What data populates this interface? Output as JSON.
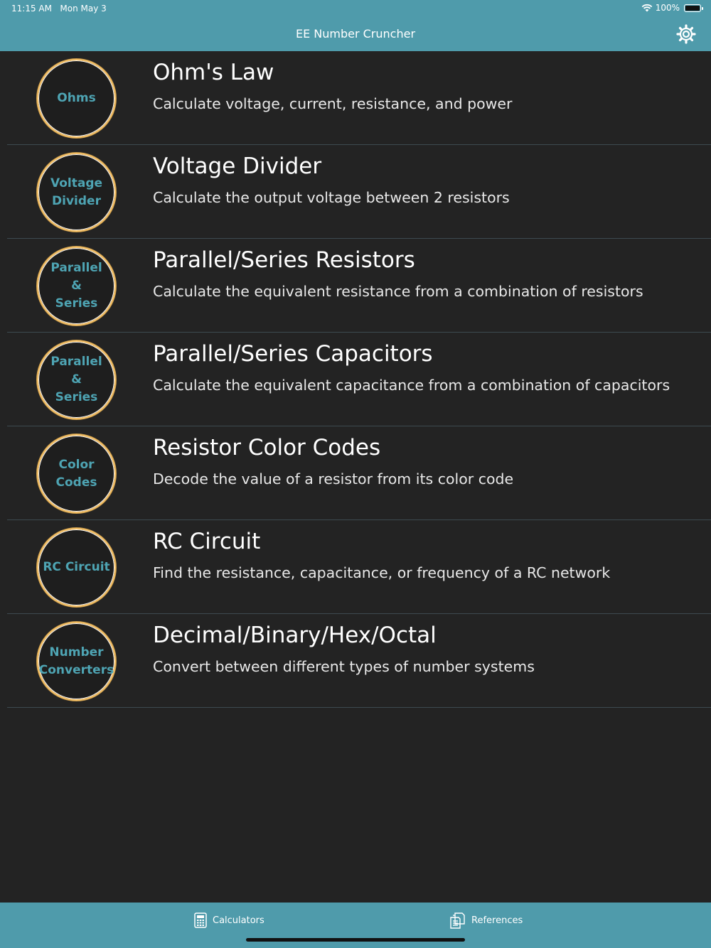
{
  "status": {
    "time": "11:15 AM",
    "date": "Mon May 3",
    "battery": "100%"
  },
  "nav": {
    "title": "EE Number Cruncher",
    "settings_icon": "gear-icon"
  },
  "calculators": [
    {
      "badge": "Ohms",
      "title": "Ohm's Law",
      "subtitle": "Calculate voltage, current, resistance, and power"
    },
    {
      "badge": "Voltage\nDivider",
      "title": "Voltage Divider",
      "subtitle": "Calculate the output voltage between 2 resistors"
    },
    {
      "badge": "Parallel\n&\nSeries",
      "title": "Parallel/Series Resistors",
      "subtitle": "Calculate the equivalent resistance from a combination of resistors"
    },
    {
      "badge": "Parallel\n&\nSeries",
      "title": "Parallel/Series Capacitors",
      "subtitle": "Calculate the equivalent capacitance from a combination of capacitors"
    },
    {
      "badge": "Color\nCodes",
      "title": "Resistor Color Codes",
      "subtitle": "Decode the value of a resistor from its color code"
    },
    {
      "badge": "RC Circuit",
      "title": "RC Circuit",
      "subtitle": "Find the resistance, capacitance, or frequency of a RC network"
    },
    {
      "badge": "Number\nConverters",
      "title": "Decimal/Binary/Hex/Octal",
      "subtitle": "Convert between different types of number systems"
    }
  ],
  "tabs": [
    {
      "label": "Calculators",
      "icon": "calculator-icon"
    },
    {
      "label": "References",
      "icon": "documents-icon"
    }
  ],
  "colors": {
    "accent": "#4f9bab",
    "background": "#232323",
    "badge_text": "#4ea4b3",
    "ring": "#f5c26a"
  }
}
